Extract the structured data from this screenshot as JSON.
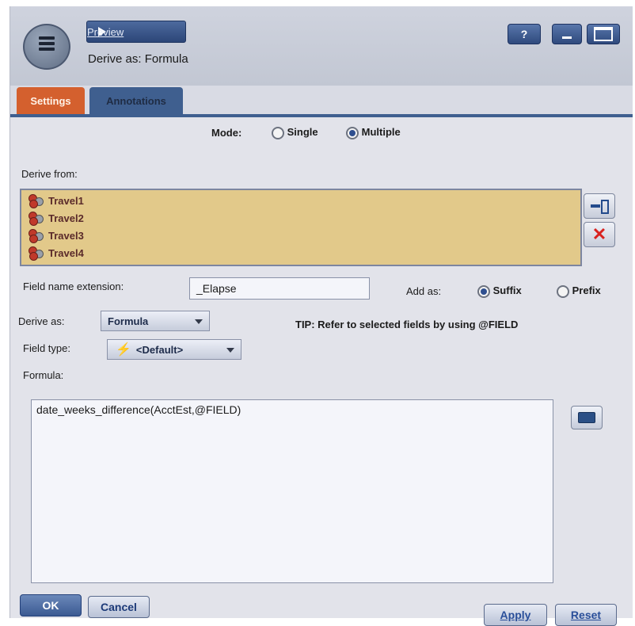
{
  "toolbar": {
    "preview_label": "Preview",
    "help_label": "?"
  },
  "dialog": {
    "title": "Derive as: Formula"
  },
  "tabs": [
    {
      "label": "Settings",
      "active": true
    },
    {
      "label": "Annotations",
      "active": false
    }
  ],
  "mode": {
    "label": "Mode:",
    "options": [
      {
        "label": "Single",
        "selected": false
      },
      {
        "label": "Multiple",
        "selected": true
      }
    ]
  },
  "derive_from": {
    "label": "Derive from:",
    "fields": [
      "Travel1",
      "Travel2",
      "Travel3",
      "Travel4"
    ]
  },
  "field_name_extension": {
    "label": "Field name extension:",
    "value": "_Elapse"
  },
  "add_as": {
    "label": "Add as:",
    "options": [
      {
        "label": "Suffix",
        "selected": true
      },
      {
        "label": "Prefix",
        "selected": false
      }
    ]
  },
  "derive_as": {
    "label": "Derive as:",
    "value": "Formula"
  },
  "tip": "TIP: Refer to selected fields by using @FIELD",
  "field_type": {
    "label": "Field type:",
    "value": "<Default>"
  },
  "formula": {
    "label": "Formula:",
    "value": "date_weeks_difference(AcctEst,@FIELD)"
  },
  "buttons": {
    "ok": "OK",
    "cancel": "Cancel",
    "apply": "Apply",
    "reset": "Reset"
  },
  "colors": {
    "settings_tab": "#d4602e",
    "annotations_tab": "#3f5f8f",
    "field_list_bg": "#e2c98a"
  }
}
